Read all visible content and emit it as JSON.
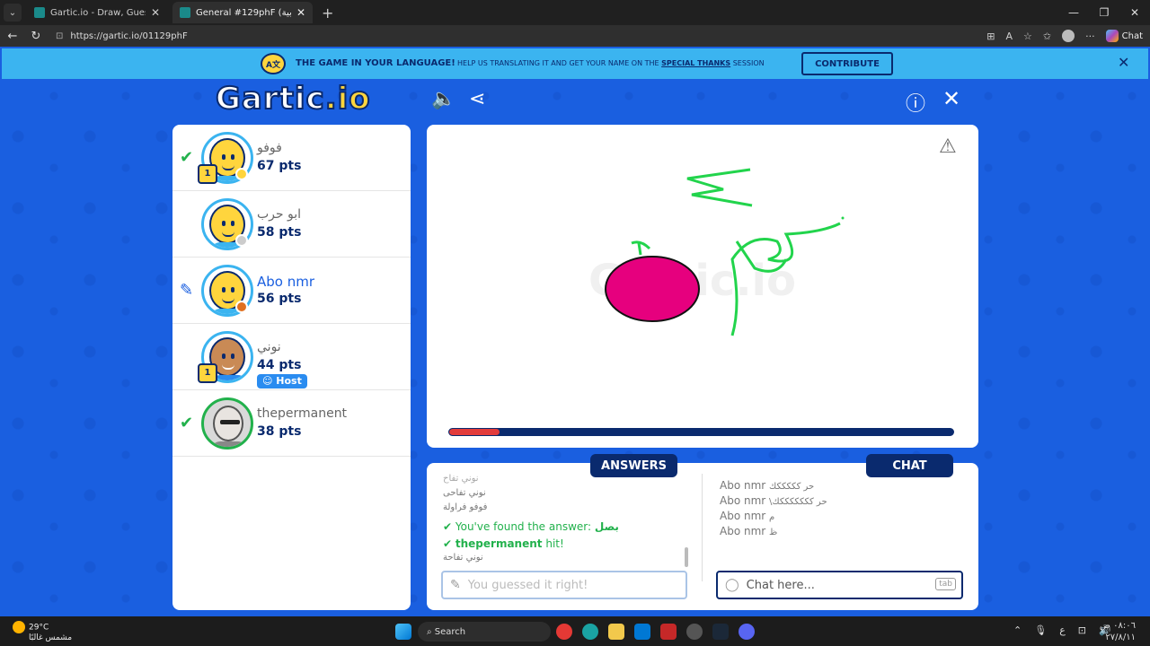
{
  "browser": {
    "tabs": [
      {
        "title": "Gartic.io - Draw, Guess, WIN",
        "active": false
      },
      {
        "title": "General #129phF (العربية) - Gartic.io",
        "active": true
      }
    ],
    "url": "https://gartic.io/01129phF",
    "chat_label": "Chat"
  },
  "banner": {
    "icon_text": "A文",
    "headline": "THE GAME IN YOUR LANGUAGE!",
    "text_before": "HELP US TRANSLATING IT AND GET YOUR NAME ON THE",
    "link": "SPECIAL THANKS",
    "text_after": "SESSION",
    "button": "CONTRIBUTE"
  },
  "logo": {
    "main": "Gartic",
    "suffix": ".io"
  },
  "players": [
    {
      "name": "فوفو",
      "points": "67 pts",
      "mark": "check",
      "status": "#ffd53d",
      "trophy": "1",
      "avatar": "smiley"
    },
    {
      "name": "ابو حرب",
      "points": "58 pts",
      "mark": "",
      "status": "#cccccc",
      "trophy": "",
      "avatar": "smiley"
    },
    {
      "name": "Abo nmr",
      "points": "56 pts",
      "mark": "pencil",
      "status": "#e07020",
      "trophy": "",
      "avatar": "smiley",
      "is_drawer": true
    },
    {
      "name": "نوني",
      "points": "44 pts",
      "mark": "",
      "status": "",
      "trophy": "1",
      "avatar": "bearded",
      "host_badge": "Host"
    },
    {
      "name": "thepermanent",
      "points": "38 pts",
      "mark": "check",
      "status": "",
      "trophy": "",
      "avatar": "photo"
    }
  ],
  "canvas": {
    "progress": 0.1,
    "colors": {
      "fruit": "#e6007e",
      "stroke": "#22d44c"
    }
  },
  "answers": {
    "tab_label": "ANSWERS",
    "lines": [
      {
        "text": "نوني تفاح",
        "kind": "plain"
      },
      {
        "text": "نوني تفاحى",
        "kind": "plain"
      },
      {
        "text": "فوفو فراولة",
        "kind": "plain"
      },
      {
        "text": "You've found the answer:",
        "answer": "بصل",
        "kind": "found"
      },
      {
        "text": "thepermanent",
        "suffix": "hit!",
        "kind": "hit"
      },
      {
        "text": "نوني تفاحة",
        "kind": "plain"
      }
    ],
    "input_placeholder": "You guessed it right!"
  },
  "chat": {
    "tab_label": "CHAT",
    "lines": [
      {
        "user": "Abo nmr",
        "text": "حر كككككك"
      },
      {
        "user": "Abo nmr",
        "text": "\\حر كككككككك"
      },
      {
        "user": "Abo nmr",
        "text": "م"
      },
      {
        "user": "Abo nmr",
        "text": "ظ"
      }
    ],
    "input_placeholder": "Chat here...",
    "tab_key": "tab"
  },
  "taskbar": {
    "temperature": "29°C",
    "weather": "مشمس غالبًا",
    "search": "Search",
    "time": "٠٨:٠٦ ص",
    "date": "٢٧/٨/١١",
    "lang": "ع"
  }
}
